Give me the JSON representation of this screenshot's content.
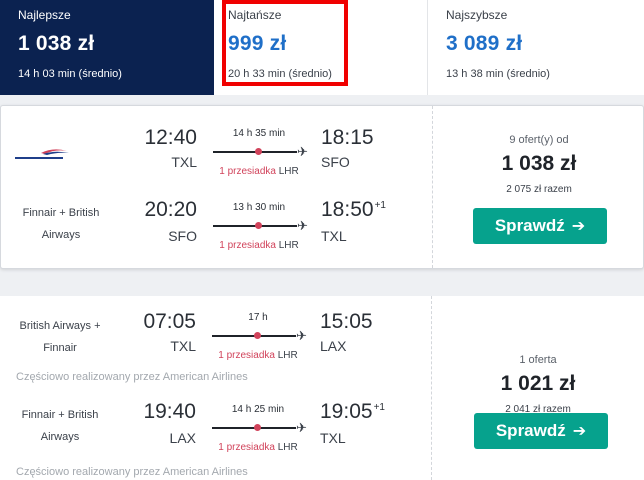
{
  "sort_tabs": [
    {
      "label": "Najlepsze",
      "price": "1 038 zł",
      "duration": "14 h 03 min (średnio)"
    },
    {
      "label": "Najtańsze",
      "price": "999 zł",
      "duration": "20 h 33 min (średnio)"
    },
    {
      "label": "Najszybsze",
      "price": "3 089 zł",
      "duration": "13 h 38 min (średnio)"
    }
  ],
  "colors": {
    "best_tab_bg": "#0b2250",
    "highlight": "#f00000",
    "accent_price": "#1f6fc8",
    "stop_red": "#d1435b",
    "button_green": "#06a28d"
  },
  "results": [
    {
      "offers": "9 ofert(y) od",
      "price": "1 038 zł",
      "total": "2 075 zł razem",
      "button_label": "Sprawdź",
      "button_icon": "arrow-right-icon",
      "legs": [
        {
          "airline": "",
          "airline_logo": "british-airways-logo",
          "dep_time": "12:40",
          "dep_code": "TXL",
          "duration": "14 h 35 min",
          "stops": "1 przesiadka",
          "stop_code": "LHR",
          "arr_time": "18:15",
          "arr_code": "SFO",
          "day_offset": ""
        },
        {
          "airline": "Finnair + British Airways",
          "dep_time": "20:20",
          "dep_code": "SFO",
          "duration": "13 h 30 min",
          "stops": "1 przesiadka",
          "stop_code": "LHR",
          "arr_time": "18:50",
          "arr_code": "TXL",
          "day_offset": "+1"
        }
      ]
    },
    {
      "offers": "1 oferta",
      "price": "1 021 zł",
      "total": "2 041 zł razem",
      "button_label": "Sprawdź",
      "button_icon": "arrow-right-icon",
      "legs": [
        {
          "airline": "British Airways + Finnair",
          "dep_time": "07:05",
          "dep_code": "TXL",
          "duration": "17 h",
          "stops": "1 przesiadka",
          "stop_code": "LHR",
          "arr_time": "15:05",
          "arr_code": "LAX",
          "day_offset": "",
          "operated_by": "Częściowo realizowany przez American Airlines"
        },
        {
          "airline": "Finnair + British Airways",
          "dep_time": "19:40",
          "dep_code": "LAX",
          "duration": "14 h 25 min",
          "stops": "1 przesiadka",
          "stop_code": "LHR",
          "arr_time": "19:05",
          "arr_code": "TXL",
          "day_offset": "+1",
          "operated_by": "Częściowo realizowany przez American Airlines"
        }
      ]
    }
  ]
}
